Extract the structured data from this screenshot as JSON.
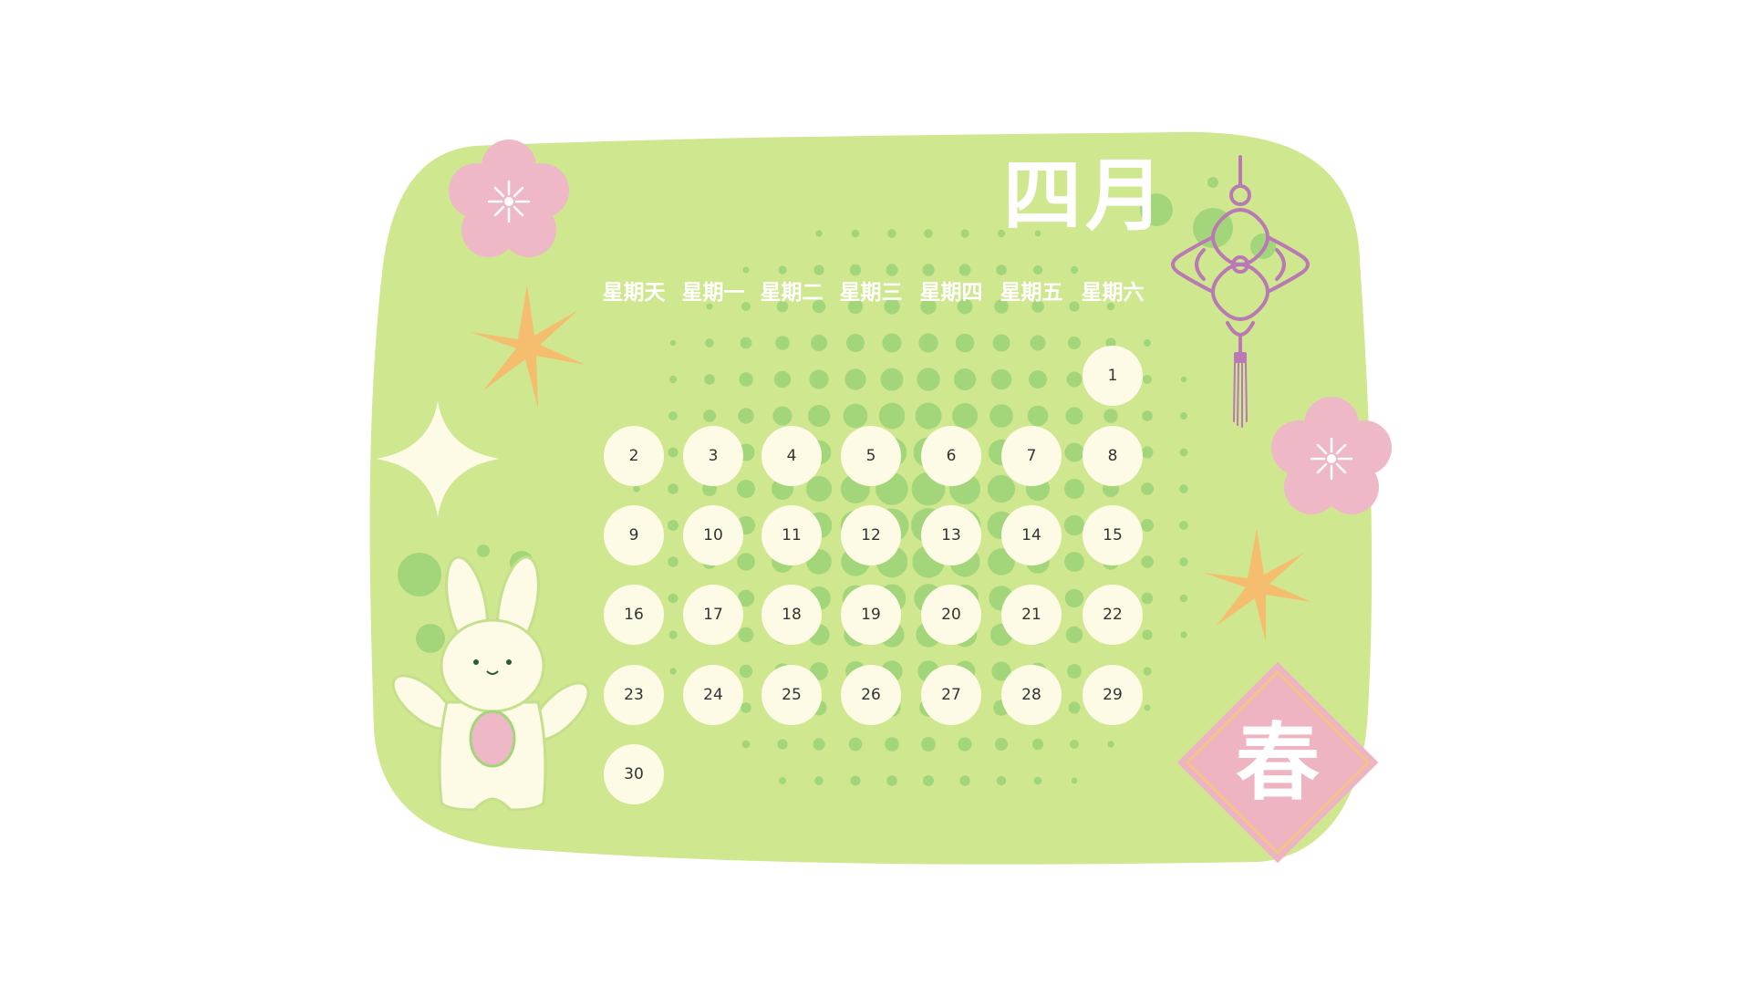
{
  "calendar": {
    "month_title": "四月",
    "weekdays": [
      "星期天",
      "星期一",
      "星期二",
      "星期三",
      "星期四",
      "星期五",
      "星期六"
    ],
    "days": [
      "1",
      "2",
      "3",
      "4",
      "5",
      "6",
      "7",
      "8",
      "9",
      "10",
      "11",
      "12",
      "13",
      "14",
      "15",
      "16",
      "17",
      "18",
      "19",
      "20",
      "21",
      "22",
      "23",
      "24",
      "25",
      "26",
      "27",
      "28",
      "29",
      "30"
    ]
  },
  "decor": {
    "spring_character": "春",
    "icons": [
      "plum-blossom-icon",
      "sparkle-star-icon",
      "chinese-knot-icon",
      "rabbit-illustration",
      "spring-diamond-icon"
    ]
  },
  "colors": {
    "background": "#ffffff",
    "card": "#cfe78f",
    "dots": "#a3d67a",
    "day_circle": "#fdfbe6",
    "blossom": "#eeb8c7",
    "star_orange": "#f5bd6e",
    "knot": "#b879b4",
    "diamond": "#eeb4c2"
  }
}
